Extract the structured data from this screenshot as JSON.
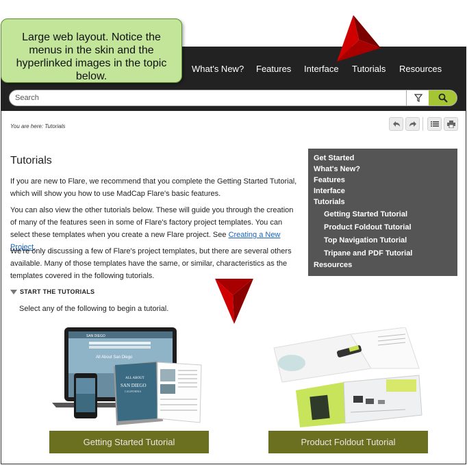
{
  "callout": {
    "text": "Large web layout. Notice the menus in the skin and the hyperlinked images in the topic below."
  },
  "nav": {
    "items": [
      "What's New?",
      "Features",
      "Interface",
      "Tutorials",
      "Resources"
    ]
  },
  "search": {
    "placeholder": "Search",
    "filter_icon": "filter-icon",
    "search_icon": "search-icon"
  },
  "breadcrumb": {
    "text": "You are here: Tutorials"
  },
  "toolbar": {
    "icons": [
      "back-icon",
      "forward-icon",
      "expand-all-icon",
      "print-icon"
    ]
  },
  "topic": {
    "title": "Tutorials",
    "p1": "If you are new to Flare, we recommend that you complete the Getting Started Tutorial, which will show you how to use MadCap Flare's basic features.",
    "p2": "You can also view the other tutorials below. These will guide you through the creation of many of the features seen in some of Flare's factory project templates. You can select these templates when you create a new Flare project. See ",
    "p2_link": "Creating a New Project",
    "p2_end": ".",
    "p3": "We're only discussing a few of Flare's project templates, but there are several others available. Many of those templates have the same, or similar, characteristics as the templates covered in the following tutorials.",
    "toggler": "START THE TUTORIALS",
    "select_text": "Select any of the following to begin a tutorial."
  },
  "side_menu": {
    "items": [
      "Get Started",
      "What's New?",
      "Features",
      "Interface",
      "Tutorials"
    ],
    "sub_items": [
      "Getting Started Tutorial",
      "Product Foldout Tutorial",
      "Top Navigation Tutorial",
      "Tripane and PDF Tutorial"
    ],
    "last": "Resources"
  },
  "tutorials": {
    "left_label": "Getting Started Tutorial",
    "right_label": "Product Foldout Tutorial",
    "left_image_text": [
      "SAN DIEGO",
      "All About San Diego",
      "ALL ABOUT",
      "SAN DIEGO",
      "CALIFORNIA"
    ]
  },
  "colors": {
    "accent": "#a5c534",
    "button": "#6b6f20",
    "topbar": "#222222",
    "menu": "#555555",
    "callout": "#c2e59a",
    "arrow": "#c00000"
  }
}
